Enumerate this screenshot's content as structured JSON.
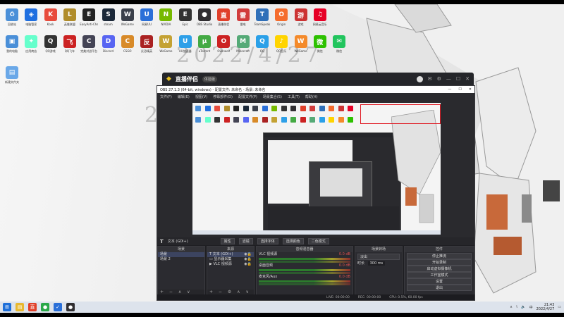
{
  "desktop": {
    "watermark_text": "2022/4/27",
    "icons": [
      {
        "label": "回收站",
        "color": "#4a8fd8",
        "glyph": "♻"
      },
      {
        "label": "电脑管家",
        "color": "#1f6fe0",
        "glyph": "◈"
      },
      {
        "label": "Kook",
        "color": "#e84c3d",
        "glyph": "K"
      },
      {
        "label": "英雄联盟",
        "color": "#b08c2a",
        "glyph": "L"
      },
      {
        "label": "EasyAnti-Cheat",
        "color": "#222",
        "glyph": "E"
      },
      {
        "label": "steam",
        "color": "#1b2838",
        "glyph": "S"
      },
      {
        "label": "WeGame",
        "color": "#3a3f4a",
        "glyph": "W"
      },
      {
        "label": "网易UU",
        "color": "#2a6fd8",
        "glyph": "U"
      },
      {
        "label": "NVIDIA",
        "color": "#76b900",
        "glyph": "N"
      },
      {
        "label": "Epic",
        "color": "#333",
        "glyph": "E"
      },
      {
        "label": "OBS Studio",
        "color": "#302e31",
        "glyph": "●"
      },
      {
        "label": "直播伴侣",
        "color": "#e0402a",
        "glyph": "直"
      },
      {
        "label": "雷电",
        "color": "#d13c3c",
        "glyph": "雷"
      },
      {
        "label": "TeamSpeak",
        "color": "#2f6fb8",
        "glyph": "T"
      },
      {
        "label": "Origin",
        "color": "#f56c2d",
        "glyph": "O"
      },
      {
        "label": "游戏",
        "color": "#c33",
        "glyph": "游"
      },
      {
        "label": "网易云音乐",
        "color": "#e60026",
        "glyph": "♫"
      },
      {
        "label": "我的电脑",
        "color": "#4a8fd8",
        "glyph": "▣"
      },
      {
        "label": "应用商店",
        "color": "#6fc",
        "glyph": "✦"
      },
      {
        "label": "QQ游戏",
        "color": "#333",
        "glyph": "Q"
      },
      {
        "label": "QQ飞车",
        "color": "#c22",
        "glyph": "飞"
      },
      {
        "label": "完美对战平台",
        "color": "#445",
        "glyph": "C"
      },
      {
        "label": "Discord",
        "color": "#5865f2",
        "glyph": "D"
      },
      {
        "label": "CSGO",
        "color": "#d88a28",
        "glyph": "C"
      },
      {
        "label": "反恐精英",
        "color": "#a22",
        "glyph": "反"
      },
      {
        "label": "WeGame",
        "color": "#c4a233",
        "glyph": "W"
      },
      {
        "label": "UU加速器",
        "color": "#2ea0e8",
        "glyph": "U"
      },
      {
        "label": "uTorrent",
        "color": "#4a4",
        "glyph": "μ"
      },
      {
        "label": "Overwolf",
        "color": "#c22",
        "glyph": "O"
      },
      {
        "label": "Minecraft",
        "color": "#5a7",
        "glyph": "M"
      },
      {
        "label": "QQ",
        "color": "#2aa0e8",
        "glyph": "Q"
      },
      {
        "label": "QQ音乐",
        "color": "#ffd400",
        "glyph": "♪"
      },
      {
        "label": "WeGame",
        "color": "#f48a2a",
        "glyph": "W"
      },
      {
        "label": "微信",
        "color": "#2dc100",
        "glyph": "微"
      },
      {
        "label": "微信",
        "color": "#22c55e",
        "glyph": "✉"
      },
      {
        "label": "新建文件夹",
        "color": "#6aa8e8",
        "glyph": "▤"
      }
    ]
  },
  "helper": {
    "title": "直播伴侣",
    "version_badge": "体验版",
    "right_icons": [
      "avatar",
      "message-icon",
      "settings-icon",
      "minimize-icon",
      "maximize-icon",
      "close-icon"
    ]
  },
  "obs": {
    "window_title": "OBS 27.1.3 (64-bit, windows) - 配置文件: 未命名 - 场景: 未命名",
    "window_controls": [
      "—",
      "☐",
      "✕"
    ],
    "menu": [
      "文件(F)",
      "编辑(E)",
      "视图(V)",
      "停靠部件(D)",
      "配置文件(P)",
      "场景集合(S)",
      "工具(T)",
      "帮助(H)"
    ],
    "source_toolbar": {
      "current_source": "文本 (GDI+)",
      "properties": "属性",
      "filters": "滤镜",
      "select_text": "选择字体",
      "select_color": "选择颜色",
      "extra": "二色模式"
    },
    "scenes": {
      "header": "场景",
      "items": [
        "场景",
        "场景 2"
      ]
    },
    "sources": {
      "header": "来源",
      "items": [
        "文本 (GDI+)",
        "显示器采集",
        "VLC 视频源"
      ]
    },
    "mixer": {
      "header": "音频混音器",
      "channels": [
        {
          "name": "VLC 视频源",
          "level": "0.0 dB"
        },
        {
          "name": "桌面音频",
          "level": "0.0 dB"
        },
        {
          "name": "麦克风/Aux",
          "level": "0.0 dB"
        }
      ]
    },
    "transitions": {
      "header": "场景转场",
      "selected": "淡出",
      "duration_label": "时长",
      "duration_value": "300 ms"
    },
    "controls": {
      "header": "控件",
      "buttons": [
        "停止推流",
        "开始录制",
        "启动虚拟摄像机",
        "工作室模式",
        "设置",
        "退出"
      ]
    },
    "status": {
      "live": "LIVE: 00:00:00",
      "rec": "REC: 00:00:00",
      "cpu": "CPU: 0.5%, 60.00 fps"
    }
  },
  "taskbar": {
    "apps": [
      {
        "name": "windows-start-icon",
        "color": "#1e6fd9",
        "glyph": "⊞"
      },
      {
        "name": "file-explorer-icon",
        "color": "#e8b830",
        "glyph": "▤"
      },
      {
        "name": "live-helper-icon",
        "color": "#e0402a",
        "glyph": "直"
      },
      {
        "name": "green-app-icon",
        "color": "#2aa84a",
        "glyph": "●"
      },
      {
        "name": "check-app-icon",
        "color": "#2a6fd8",
        "glyph": "✓"
      },
      {
        "name": "obs-icon",
        "color": "#302e31",
        "glyph": "●"
      }
    ],
    "time": "21:43",
    "date": "2022/4/27"
  }
}
